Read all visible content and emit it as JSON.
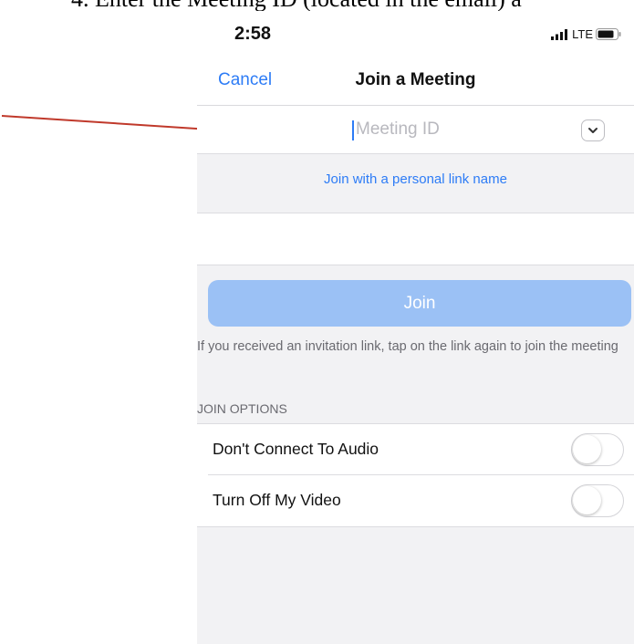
{
  "document": {
    "step_heading": "4.  Enter the Meeting ID (located in the email) a"
  },
  "status_bar": {
    "time": "2:58",
    "network": "LTE",
    "icons": [
      "signal-icon",
      "battery-icon"
    ]
  },
  "nav": {
    "cancel_label": "Cancel",
    "title": "Join a Meeting"
  },
  "meeting_id": {
    "placeholder": "Meeting ID",
    "value": "",
    "dropdown_icon": "chevron-down-icon"
  },
  "personal_link_label": "Join with a personal link name",
  "join_button_label": "Join",
  "help_text": "If you received an invitation link, tap on the link again to join the meeting",
  "join_options": {
    "title": "JOIN OPTIONS",
    "items": [
      {
        "label": "Don't Connect To Audio",
        "enabled": false
      },
      {
        "label": "Turn Off My Video",
        "enabled": false
      }
    ]
  },
  "colors": {
    "accent": "#2d7cf6",
    "join_button_disabled": "#9bc1f5",
    "annotation_arrow": "#c0392b",
    "background": "#f2f2f4"
  }
}
